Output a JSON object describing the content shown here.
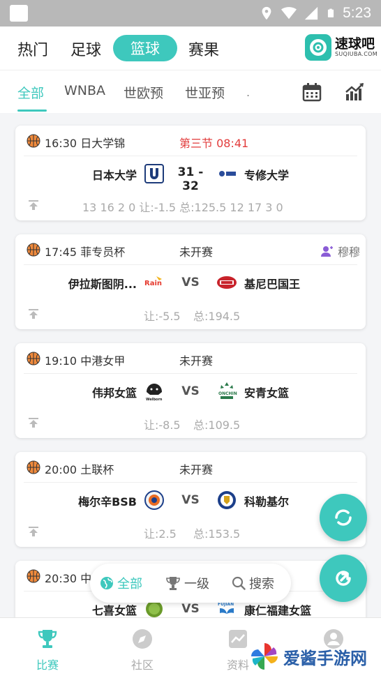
{
  "status_bar": {
    "time": "5:23"
  },
  "top_nav": {
    "items": [
      {
        "label": "热门"
      },
      {
        "label": "足球"
      },
      {
        "label": "篮球"
      },
      {
        "label": "赛果"
      }
    ],
    "logo": {
      "title": "速球吧",
      "sub": "SUQIUBA.COM"
    }
  },
  "sub_tabs": {
    "items": [
      {
        "label": "全部"
      },
      {
        "label": "WNBA"
      },
      {
        "label": "世欧预"
      },
      {
        "label": "世亚预"
      }
    ],
    "dot": "."
  },
  "matches": [
    {
      "time": "16:30",
      "league": "日大学锦",
      "status": "第三节  08:41",
      "home": "日本大学",
      "away": "专修大学",
      "score": "31 - 32",
      "odds_line": "13  16  2  0   让:-1.5     总:125.5  12  17  3  0"
    },
    {
      "time": "17:45",
      "league": "菲专员杯",
      "status": "未开赛",
      "fav": "穆穆",
      "home": "伊拉斯图阴...",
      "away": "基尼巴国王",
      "vs": "VS",
      "handicap": "让:-5.5",
      "total": "总:194.5"
    },
    {
      "time": "19:10",
      "league": "中港女甲",
      "status": "未开赛",
      "home": "伟邦女篮",
      "away": "安青女篮",
      "vs": "VS",
      "handicap": "让:-8.5",
      "total": "总:109.5"
    },
    {
      "time": "20:00",
      "league": "土联杯",
      "status": "未开赛",
      "home": "梅尔辛BSB",
      "away": "科勒基尔",
      "vs": "VS",
      "handicap": "让:2.5",
      "total": "总:153.5"
    },
    {
      "time": "20:30",
      "league": "中",
      "status": "",
      "home": "七喜女篮",
      "away": "康仁福建女篮",
      "vs": "VS"
    }
  ],
  "filter": {
    "all": "全部",
    "level1": "一级",
    "search": "搜索"
  },
  "bottom_tabs": [
    {
      "label": "比赛"
    },
    {
      "label": "社区"
    },
    {
      "label": "资料"
    },
    {
      "label": ""
    }
  ],
  "watermark": {
    "text": "爱酱手游网"
  },
  "colors": {
    "accent": "#3ec8bd",
    "live": "#e23b3b"
  }
}
